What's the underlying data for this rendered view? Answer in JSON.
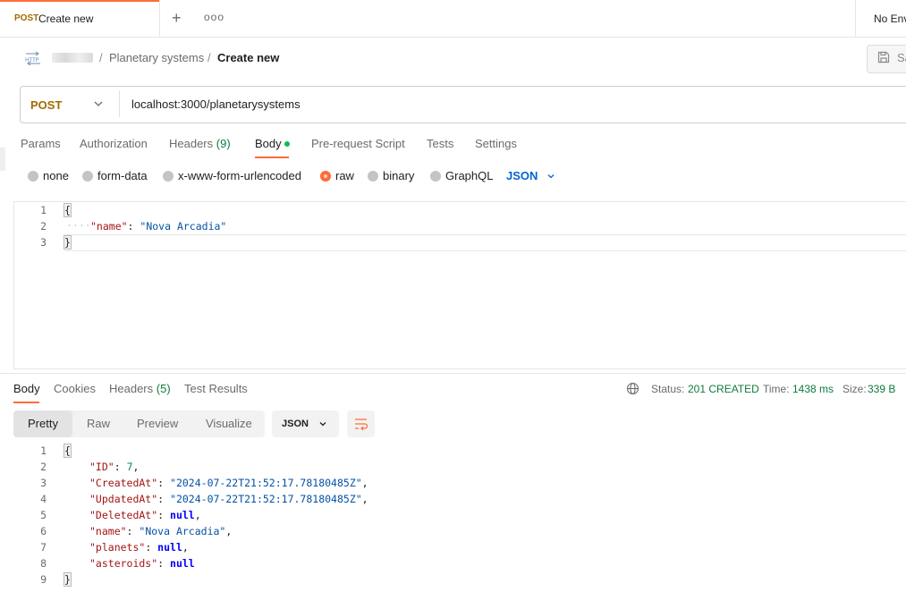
{
  "tab": {
    "method": "POST",
    "name": "Create new",
    "plus": "+",
    "more": "ooo"
  },
  "environment": {
    "label": "No Env"
  },
  "breadcrumb": {
    "sep": "/",
    "parent": "Planetary systems",
    "current": "Create new"
  },
  "save_button": {
    "label": "Sa"
  },
  "request": {
    "method": "POST",
    "url": "localhost:3000/planetarysystems",
    "tabs": [
      {
        "label": "Params"
      },
      {
        "label": "Authorization"
      },
      {
        "label": "Headers",
        "count": "(9)"
      },
      {
        "label": "Body"
      },
      {
        "label": "Pre-request Script"
      },
      {
        "label": "Tests"
      },
      {
        "label": "Settings"
      }
    ],
    "body_types": [
      "none",
      "form-data",
      "x-www-form-urlencoded",
      "raw",
      "binary",
      "GraphQL"
    ],
    "selected_body_type": "raw",
    "format": "JSON",
    "body_lines": [
      {
        "num": "1",
        "text": "{"
      },
      {
        "num": "2",
        "key": "\"name\"",
        "colon": ": ",
        "value": "\"Nova Arcadia\""
      },
      {
        "num": "3",
        "text": "}"
      }
    ]
  },
  "response": {
    "tabs": [
      {
        "label": "Body"
      },
      {
        "label": "Cookies"
      },
      {
        "label": "Headers",
        "count": "(5)"
      },
      {
        "label": "Test Results"
      }
    ],
    "status_label": "Status:",
    "status_value": "201 CREATED",
    "time_label": "Time:",
    "time_value": "1438 ms",
    "size_label": "Size:",
    "size_value": "339 B",
    "views": [
      "Pretty",
      "Raw",
      "Preview",
      "Visualize"
    ],
    "format": "JSON",
    "lines": [
      {
        "num": "1",
        "brace": "{"
      },
      {
        "num": "2",
        "key": "\"ID\"",
        "value": "7",
        "vtype": "n",
        "comma": ","
      },
      {
        "num": "3",
        "key": "\"CreatedAt\"",
        "value": "\"2024-07-22T21:52:17.78180485Z\"",
        "vtype": "s",
        "comma": ","
      },
      {
        "num": "4",
        "key": "\"UpdatedAt\"",
        "value": "\"2024-07-22T21:52:17.78180485Z\"",
        "vtype": "s",
        "comma": ","
      },
      {
        "num": "5",
        "key": "\"DeletedAt\"",
        "value": "null",
        "vtype": "kw",
        "comma": ","
      },
      {
        "num": "6",
        "key": "\"name\"",
        "value": "\"Nova Arcadia\"",
        "vtype": "s",
        "comma": ","
      },
      {
        "num": "7",
        "key": "\"planets\"",
        "value": "null",
        "vtype": "kw",
        "comma": ","
      },
      {
        "num": "8",
        "key": "\"asteroids\"",
        "value": "null",
        "vtype": "kw",
        "comma": ""
      },
      {
        "num": "9",
        "brace": "}"
      }
    ]
  },
  "colors": {
    "accent": "#ff6c37",
    "method": "#a26b00",
    "success": "#0f7a3c",
    "link": "#0265d2"
  }
}
